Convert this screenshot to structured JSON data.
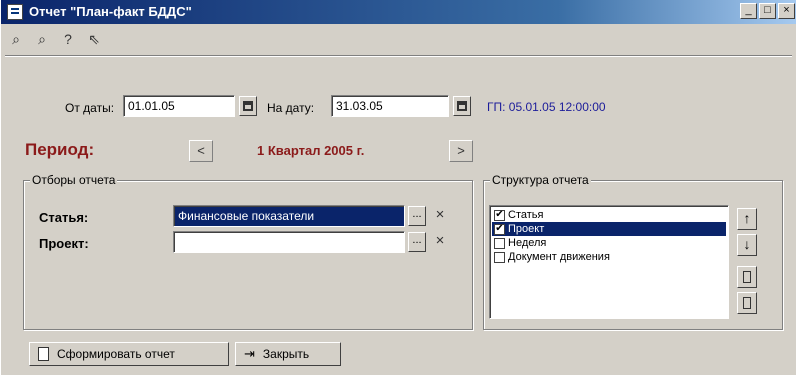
{
  "window": {
    "title": "Отчет \"План-факт БДДС\"",
    "buttons": {
      "minimize": "_",
      "maximize": "□",
      "close": "×"
    }
  },
  "toolbar": {
    "icons": [
      "binoculars-icon",
      "binoculars-next-icon",
      "help-icon",
      "whats-this-icon"
    ]
  },
  "dates": {
    "from_label": "От даты:",
    "from_value": "01.01.05",
    "to_label": "На дату:",
    "to_value": "31.03.05",
    "gp_text": "ГП: 05.01.05 12:00:00"
  },
  "period": {
    "label": "Период:",
    "prev": "<",
    "value": "1 Квартал 2005 г.",
    "next": ">"
  },
  "filters": {
    "title": "Отборы отчета",
    "article_label": "Статья:",
    "article_value": "Финансовые показатели",
    "project_label": "Проект:",
    "project_value": "",
    "dots": "...",
    "clear": "×"
  },
  "structure": {
    "title": "Структура отчета",
    "items": [
      {
        "label": "Статья",
        "checked": true,
        "selected": false
      },
      {
        "label": "Проект",
        "checked": true,
        "selected": true
      },
      {
        "label": "Неделя",
        "checked": false,
        "selected": false
      },
      {
        "label": "Документ движения",
        "checked": false,
        "selected": false
      }
    ],
    "up": "↑",
    "down": "↓"
  },
  "actions": {
    "generate_label": "Сформировать отчет",
    "close_label": "Закрыть"
  }
}
